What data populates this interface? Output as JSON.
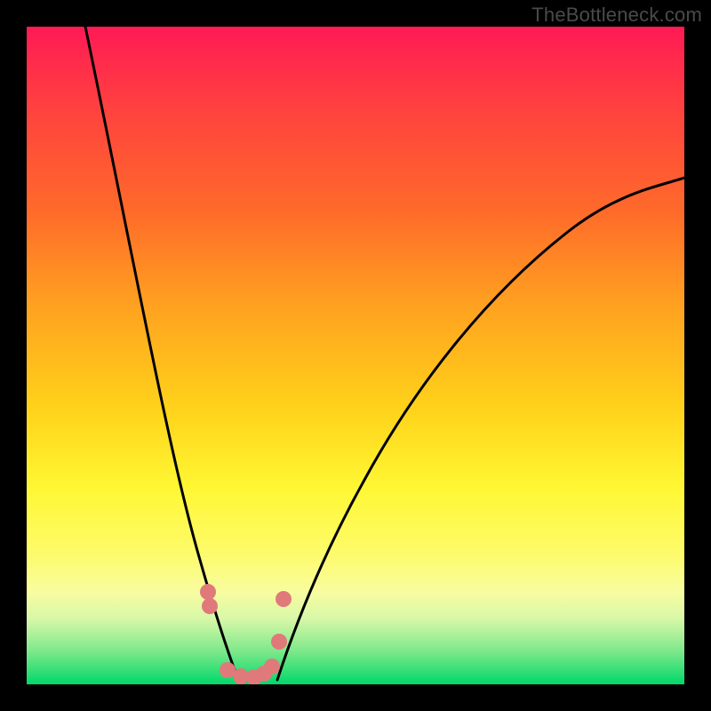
{
  "watermark": "TheBottleneck.com",
  "chart_data": {
    "type": "line",
    "title": "",
    "xlabel": "",
    "ylabel": "",
    "xlim": [
      0,
      100
    ],
    "ylim": [
      0,
      100
    ],
    "background_gradient": [
      "#ff1a55",
      "#ff4040",
      "#ff6a2a",
      "#ffa020",
      "#ffd21a",
      "#fff733",
      "#fdfb6a",
      "#f8fca0",
      "#d8f8a8",
      "#7de88a",
      "#00d86a"
    ],
    "series": [
      {
        "name": "left-curve",
        "color": "#000000",
        "x": [
          9,
          12,
          15,
          18,
          21,
          23,
          25,
          27,
          29,
          30,
          31,
          32
        ],
        "y": [
          100,
          86,
          72,
          58,
          45,
          35,
          27,
          20,
          13,
          8,
          4,
          1
        ]
      },
      {
        "name": "right-curve",
        "color": "#000000",
        "x": [
          38,
          40,
          43,
          47,
          52,
          58,
          65,
          73,
          82,
          92,
          100
        ],
        "y": [
          1,
          5,
          11,
          19,
          28,
          38,
          48,
          57,
          65,
          72,
          77
        ]
      },
      {
        "name": "marker-dots",
        "color": "#e07a7a",
        "type": "scatter",
        "x": [
          27.5,
          27.7,
          30.5,
          32.5,
          34.5,
          36.0,
          37.2,
          38.3,
          39.0
        ],
        "y": [
          14,
          12,
          2,
          1,
          1,
          2,
          3,
          7,
          13
        ]
      }
    ]
  }
}
